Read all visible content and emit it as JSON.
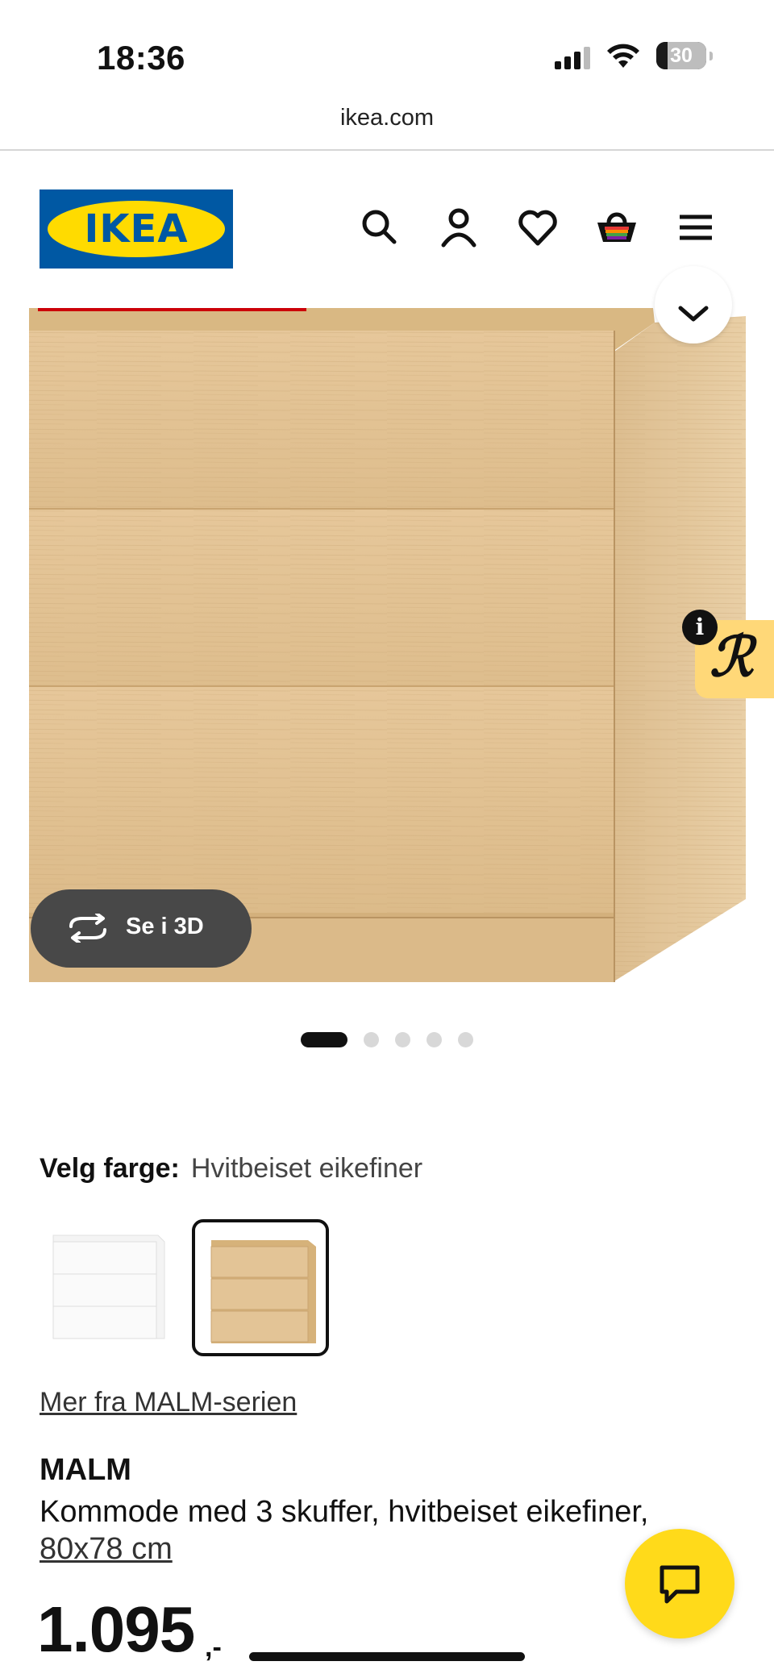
{
  "status_bar": {
    "time": "18:36",
    "battery": "30"
  },
  "browser": {
    "url": "ikea.com"
  },
  "header": {
    "logo_text": "IKEA",
    "icons": [
      "search-icon",
      "account-icon",
      "heart-icon",
      "cart-icon",
      "menu-icon"
    ]
  },
  "gallery": {
    "view_3d_label": "Se i 3D",
    "slide_count": 5,
    "active_slide": 1
  },
  "color_picker": {
    "label": "Velg farge:",
    "selected_value": "Hvitbeiset eikefiner",
    "options": [
      "white",
      "white-stained-oak"
    ]
  },
  "product": {
    "series_link": "Mer fra MALM-serien",
    "name": "MALM",
    "description": "Kommode med 3 skuffer, hvitbeiset eikefiner,",
    "size": "80x78 cm",
    "price": "1.095",
    "price_suffix": ",-"
  },
  "colors": {
    "ikea_blue": "#0058a3",
    "ikea_yellow": "#ffdb00",
    "chat_yellow": "#ffda1a",
    "oak": "#e2c294"
  }
}
